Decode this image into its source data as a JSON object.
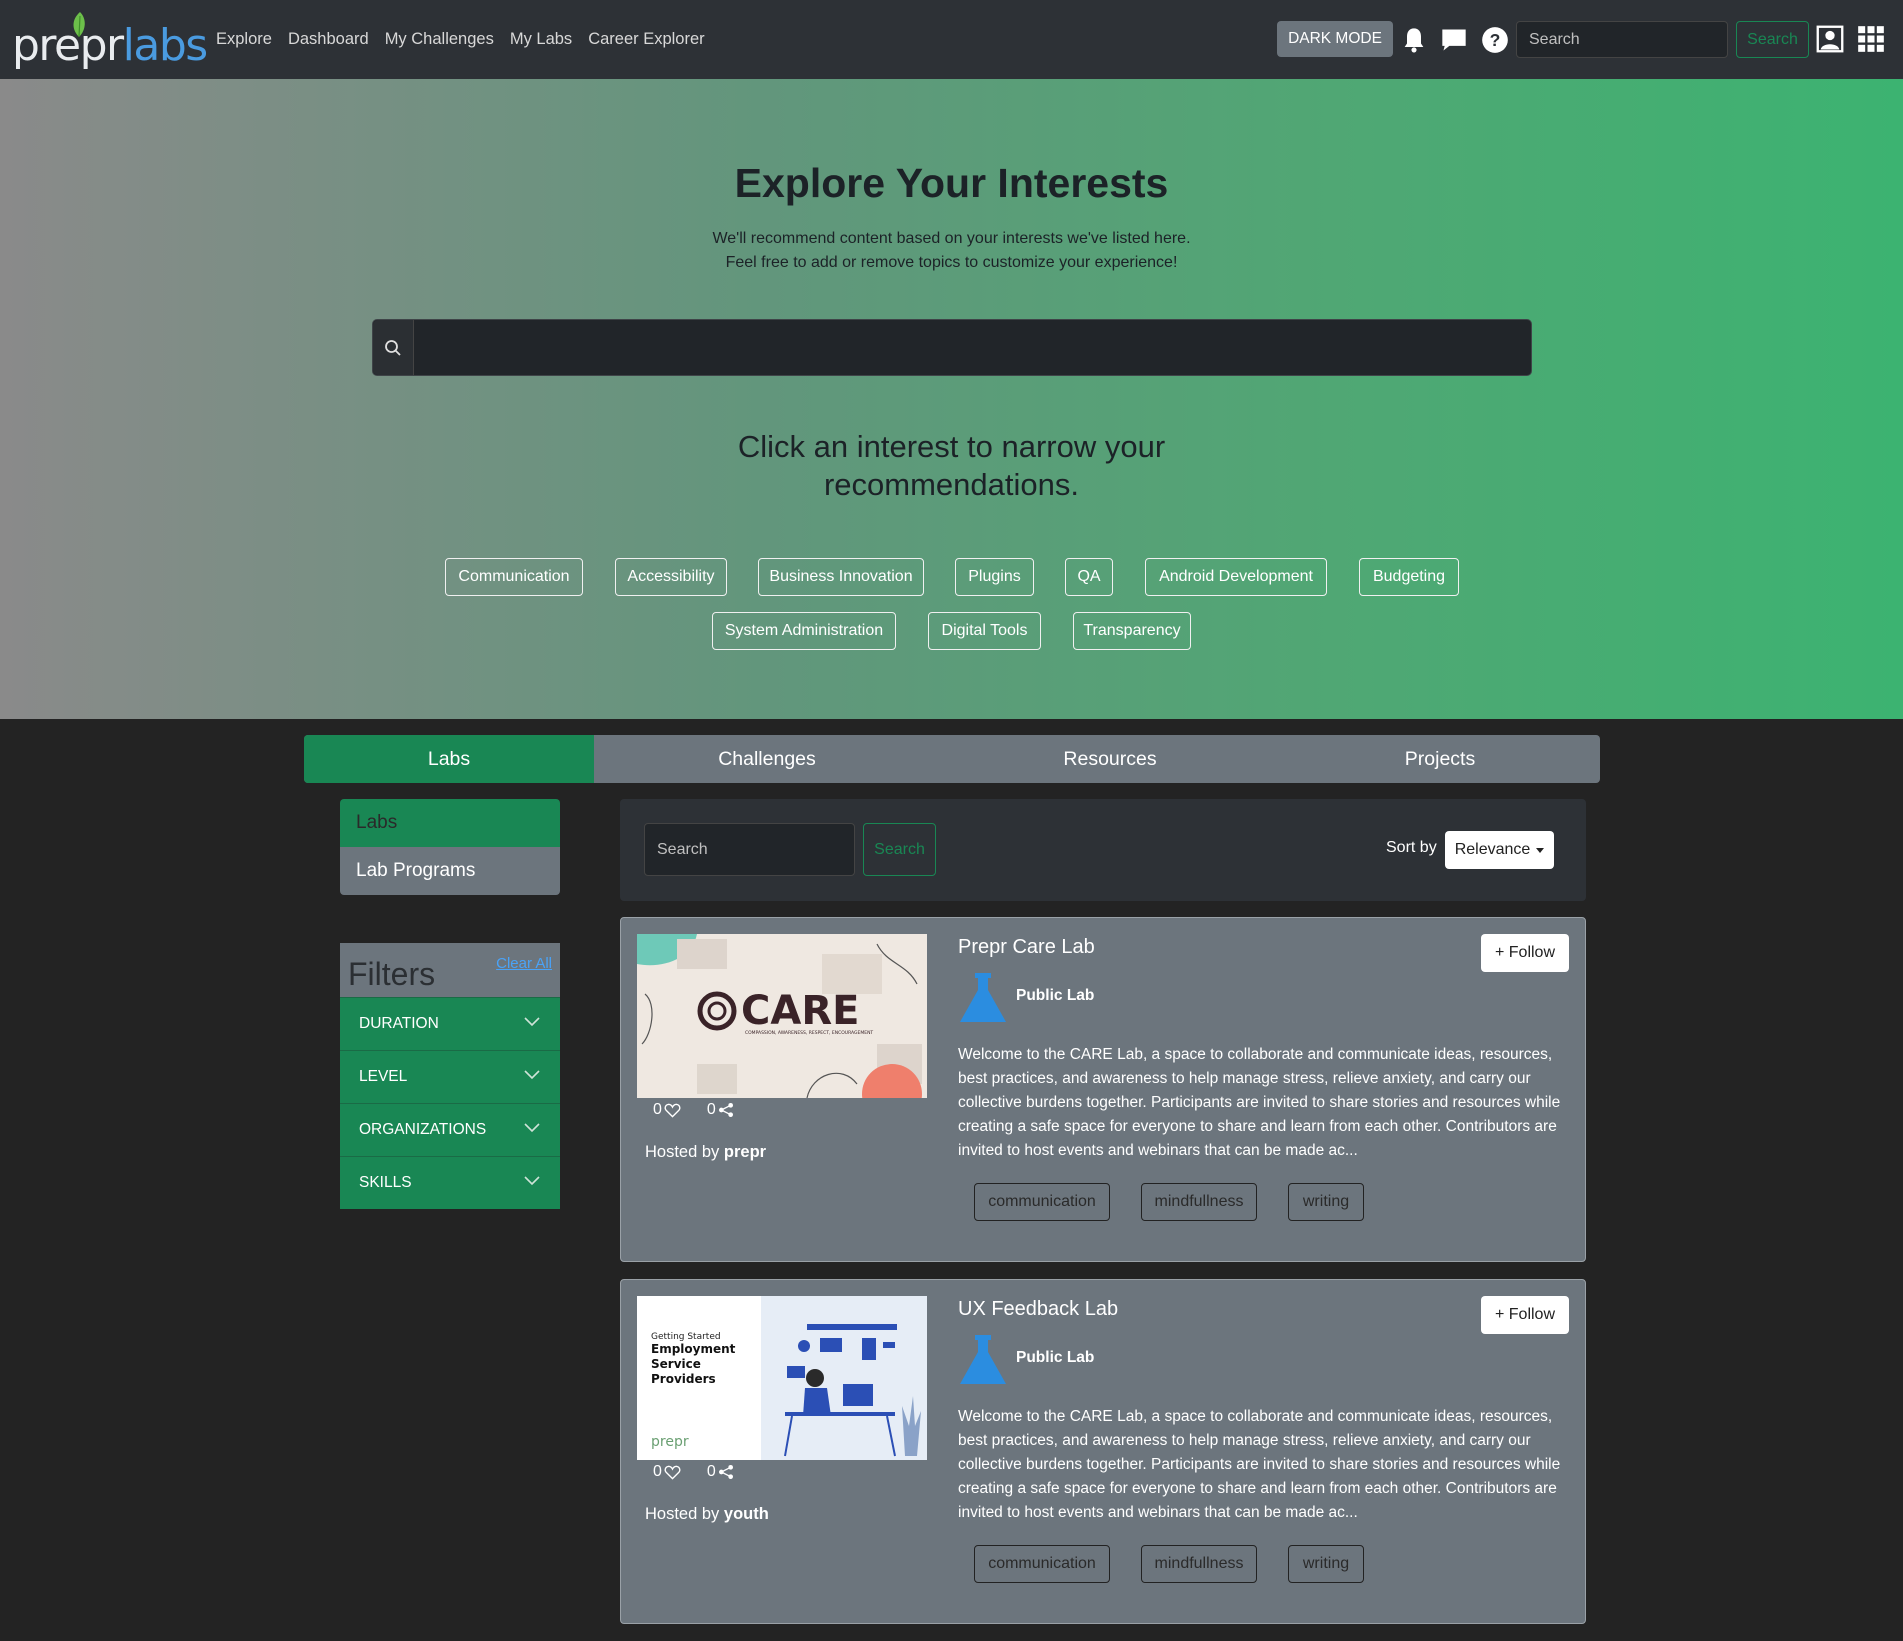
{
  "nav": {
    "logo_part1": "prepr",
    "logo_part2": "labs",
    "links": [
      "Explore",
      "Dashboard",
      "My Challenges",
      "My Labs",
      "Career Explorer"
    ],
    "dark_mode_label": "DARK MODE",
    "search_placeholder": "Search",
    "search_button": "Search"
  },
  "hero": {
    "title": "Explore Your Interests",
    "subtitle_line1": "We'll recommend content based on your interests we've listed here.",
    "subtitle_line2": "Feel free to add or remove topics to customize your experience!",
    "search_value": "",
    "heading_line1": "Click an interest to narrow your",
    "heading_line2": "recommendations.",
    "interests": [
      "Communication",
      "Accessibility",
      "Business Innovation",
      "Plugins",
      "QA",
      "Android Development",
      "Budgeting",
      "System Administration",
      "Digital Tools",
      "Transparency"
    ]
  },
  "tabs": [
    "Labs",
    "Challenges",
    "Resources",
    "Projects"
  ],
  "side_nav": [
    "Labs",
    "Lab Programs"
  ],
  "filters": {
    "title": "Filters",
    "clear_label": "Clear All",
    "items": [
      "DURATION",
      "LEVEL",
      "ORGANIZATIONS",
      "SKILLS"
    ]
  },
  "search_panel": {
    "placeholder": "Search",
    "button": "Search",
    "sort_label": "Sort by",
    "sort_value": "Relevance"
  },
  "cards": [
    {
      "title": "Prepr Care Lab",
      "type": "Public Lab",
      "follow": "+ Follow",
      "likes": "0",
      "shares": "0",
      "hosted_prefix": "Hosted by",
      "host": "prepr",
      "thumb_text": "CARE",
      "thumb_sub": "COMPASSION, AWARENESS, RESPECT, ENCOURAGEMENT",
      "description": "Welcome to the CARE Lab, a space to collaborate and communicate ideas, resources, best practices, and awareness to help manage stress, relieve anxiety, and carry our collective burdens together. Participants are invited to share stories and resources while creating a safe space for everyone to share and learn from each other. Contributors are invited to host events and webinars that can be made ac...",
      "tags": [
        "communication",
        "mindfullness",
        "writing"
      ]
    },
    {
      "title": "UX Feedback Lab",
      "type": "Public Lab",
      "follow": "+ Follow",
      "likes": "0",
      "shares": "0",
      "hosted_prefix": "Hosted by",
      "host": "youth",
      "thumb_small": "Getting Started",
      "thumb_line1": "Employment",
      "thumb_line2": "Service",
      "thumb_line3": "Providers",
      "thumb_logo": "prepr",
      "description": "Welcome to the CARE Lab, a space to collaborate and communicate ideas, resources, best practices, and awareness to help manage stress, relieve anxiety, and carry our collective burdens together. Participants are invited to share stories and resources while creating a safe space for everyone to share and learn from each other. Contributors are invited to host events and webinars that can be made ac...",
      "tags": [
        "communication",
        "mindfullness",
        "writing"
      ]
    }
  ],
  "colors": {
    "accent": "#198754",
    "navbar": "#2d3136",
    "card": "#6c757d",
    "link": "#4aa3f7",
    "flask": "#2b8de0"
  }
}
